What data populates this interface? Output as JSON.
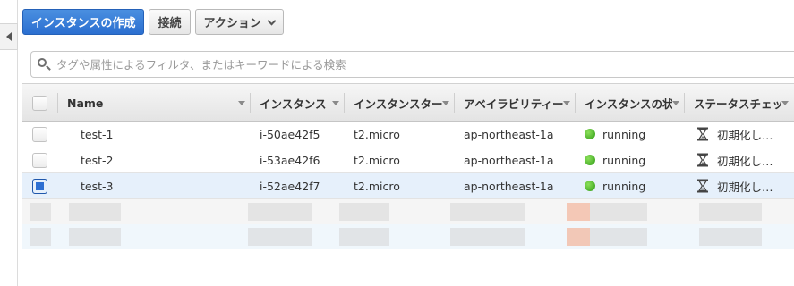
{
  "toolbar": {
    "launch_label": "インスタンスの作成",
    "connect_label": "接続",
    "actions_label": "アクション"
  },
  "search": {
    "placeholder": "タグや属性によるフィルタ、またはキーワードによる検索"
  },
  "table": {
    "columns": [
      "Name",
      "インスタンス",
      "インスタンスター",
      "アベイラビリティー",
      "インスタンスの状",
      "ステータスチェッ"
    ],
    "rows": [
      {
        "name": "test-1",
        "instance_id": "i-50ae42f5",
        "type": "t2.micro",
        "az": "ap-northeast-1a",
        "state": "running",
        "status": "初期化し…",
        "selected": false
      },
      {
        "name": "test-2",
        "instance_id": "i-53ae42f6",
        "type": "t2.micro",
        "az": "ap-northeast-1a",
        "state": "running",
        "status": "初期化し…",
        "selected": false
      },
      {
        "name": "test-3",
        "instance_id": "i-52ae42f7",
        "type": "t2.micro",
        "az": "ap-northeast-1a",
        "state": "running",
        "status": "初期化し…",
        "selected": true
      }
    ]
  },
  "colors": {
    "primary_button": "#2b6fd0",
    "running": "#2f9b16",
    "selected_row": "#e6f0fb"
  },
  "icons": {
    "collapse": "triangle-left-icon",
    "search": "search-icon",
    "dropdown": "chevron-down-icon",
    "state": "status-dot-icon",
    "status_check": "hourglass-icon"
  }
}
